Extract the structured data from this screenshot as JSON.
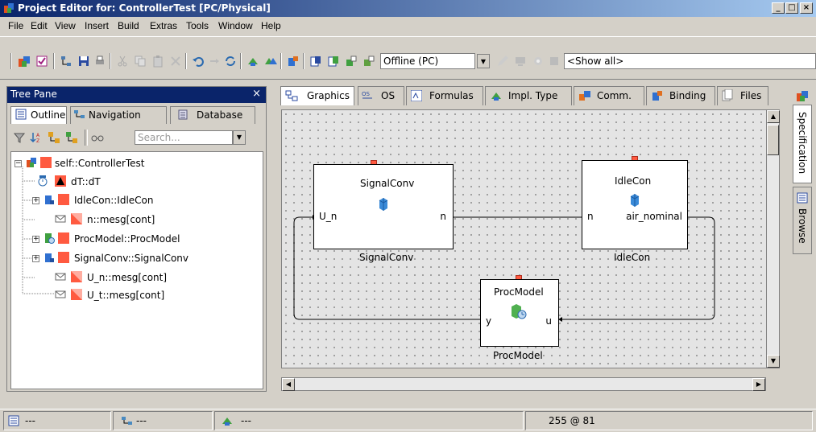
{
  "window": {
    "title": "Project Editor for: ControllerTest [PC/Physical]",
    "controls": [
      "_",
      "□",
      "×"
    ]
  },
  "menu": [
    "File",
    "Edit",
    "View",
    "Insert",
    "Build",
    "Extras",
    "Tools",
    "Window",
    "Help"
  ],
  "toolbar": {
    "mode_select": "Offline (PC)",
    "filter_select": "<Show all>"
  },
  "tree_pane": {
    "title": "Tree Pane",
    "close": "×",
    "tabs": [
      "Outline",
      "Navigation",
      "Database"
    ],
    "search_placeholder": "Search...",
    "items": [
      {
        "label": "self::ControllerTest"
      },
      {
        "label": "dT::dT"
      },
      {
        "label": "IdleCon::IdleCon"
      },
      {
        "label": "n::mesg[cont]"
      },
      {
        "label": "ProcModel::ProcModel"
      },
      {
        "label": "SignalConv::SignalConv"
      },
      {
        "label": "U_n::mesg[cont]"
      },
      {
        "label": "U_t::mesg[cont]"
      }
    ]
  },
  "main_tabs": [
    "Graphics",
    "OS",
    "Formulas",
    "Impl. Type",
    "Comm.",
    "Binding",
    "Files"
  ],
  "diagram": {
    "blocks": [
      {
        "title": "SignalConv",
        "caption": "SignalConv",
        "in_port": "U_n",
        "out_port": "n"
      },
      {
        "title": "IdleCon",
        "caption": "IdleCon",
        "in_port": "n",
        "out_port": "air_nominal"
      },
      {
        "title": "ProcModel",
        "caption": "ProcModel",
        "in_port": "u",
        "out_port": "y"
      }
    ]
  },
  "side_tabs": [
    "Specification",
    "Browse"
  ],
  "status": {
    "cells": [
      "---",
      "---",
      "---"
    ],
    "coords": "255 @ 81"
  },
  "colors": {
    "titlebar_start": "#0a246a",
    "titlebar_end": "#a6caf0",
    "port": "#ff5a40",
    "face": "#d4d0c8"
  }
}
